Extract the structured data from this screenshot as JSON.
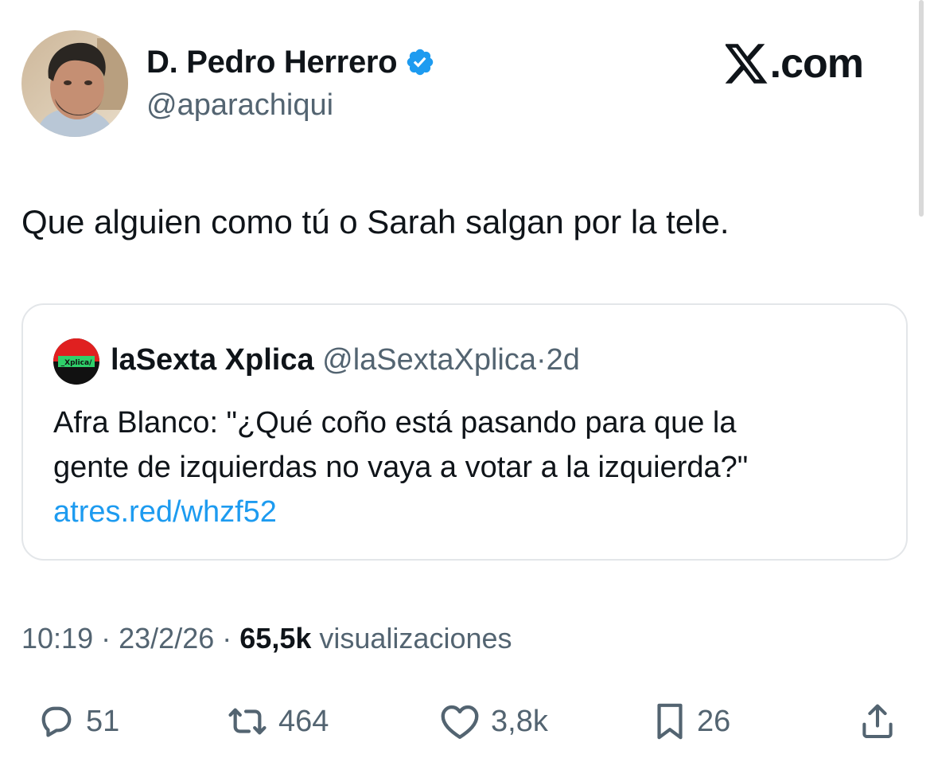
{
  "author": {
    "name": "D. Pedro Herrero",
    "handle": "@aparachiqui",
    "verified": true
  },
  "brand": {
    "text": ".com",
    "icon": "x-logo-icon"
  },
  "tweet": {
    "text": "Que alguien como tú o Sarah salgan por la tele."
  },
  "quote": {
    "avatar_label": "_Xplica/",
    "name": "laSexta Xplica",
    "handle": "@laSextaXplica",
    "separator": "·",
    "time": "2d",
    "lines": [
      "Afra Blanco: \"¿Qué coño está pasando para que la",
      "gente de izquierdas no vaya a votar a la izquierda?\""
    ],
    "link": "atres.red/whzf52"
  },
  "meta": {
    "time": "10:19",
    "sep1": "·",
    "date": "23/2/26",
    "sep2": "·",
    "views": "65,5k",
    "views_label": "visualizaciones"
  },
  "actions": {
    "replies": "51",
    "retweets": "464",
    "likes": "3,8k",
    "bookmarks": "26"
  },
  "colors": {
    "text": "#0f1419",
    "secondary": "#536471",
    "link": "#1d9bf0",
    "verified": "#1d9bf0",
    "border": "#e3e6e9"
  }
}
